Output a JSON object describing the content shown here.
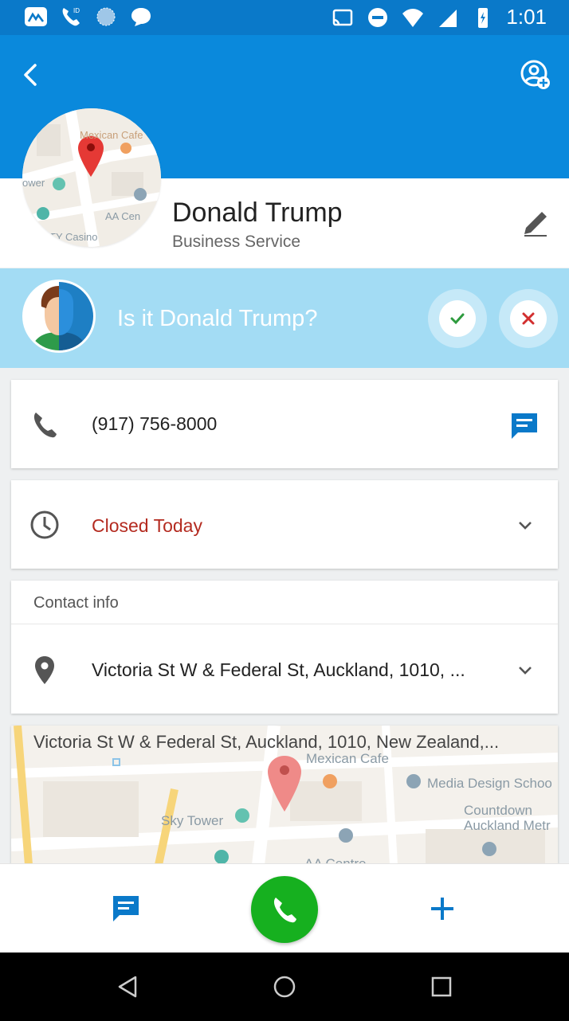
{
  "status_bar": {
    "time": "1:01",
    "icons": [
      "app-icon",
      "phone-id-icon",
      "sphere-icon",
      "chat-bubble-icon",
      "cast-icon",
      "do-not-disturb-icon",
      "wifi-icon",
      "signal-icon",
      "battery-charging-icon"
    ]
  },
  "header": {
    "back_icon": "chevron-left-icon",
    "add_contact_icon": "add-contact-icon",
    "brand_color": "#0a89dc"
  },
  "contact": {
    "name": "Donald Trump",
    "category": "Business Service",
    "edit_icon": "pencil-icon"
  },
  "verify": {
    "question": "Is it Donald Trump?",
    "confirm_icon": "check-icon",
    "reject_icon": "close-icon"
  },
  "phone": {
    "number": "(917) 756-8000",
    "message_icon": "message-icon"
  },
  "hours": {
    "status": "Closed Today",
    "status_color": "#b42b20"
  },
  "contact_info": {
    "label": "Contact info",
    "address": "Victoria St W & Federal St, Auckland, 1010, ..."
  },
  "map": {
    "address_full": "Victoria St W & Federal St, Auckland, 1010, New Zealand,...",
    "labels": {
      "cafe": "Mexican Cafe",
      "sky_tower": "Sky Tower",
      "media_school": "Media Design Schoo",
      "countdown_1": "Countdown",
      "countdown_2": "Auckland Metr",
      "aa_centre": "AA Centre"
    },
    "avatar_labels": {
      "cafe": "Mexican Cafe",
      "tower": "ower",
      "aa": "AA Cen",
      "casino": "TY Casino"
    }
  },
  "actions": {
    "call_color": "#16b01f"
  }
}
